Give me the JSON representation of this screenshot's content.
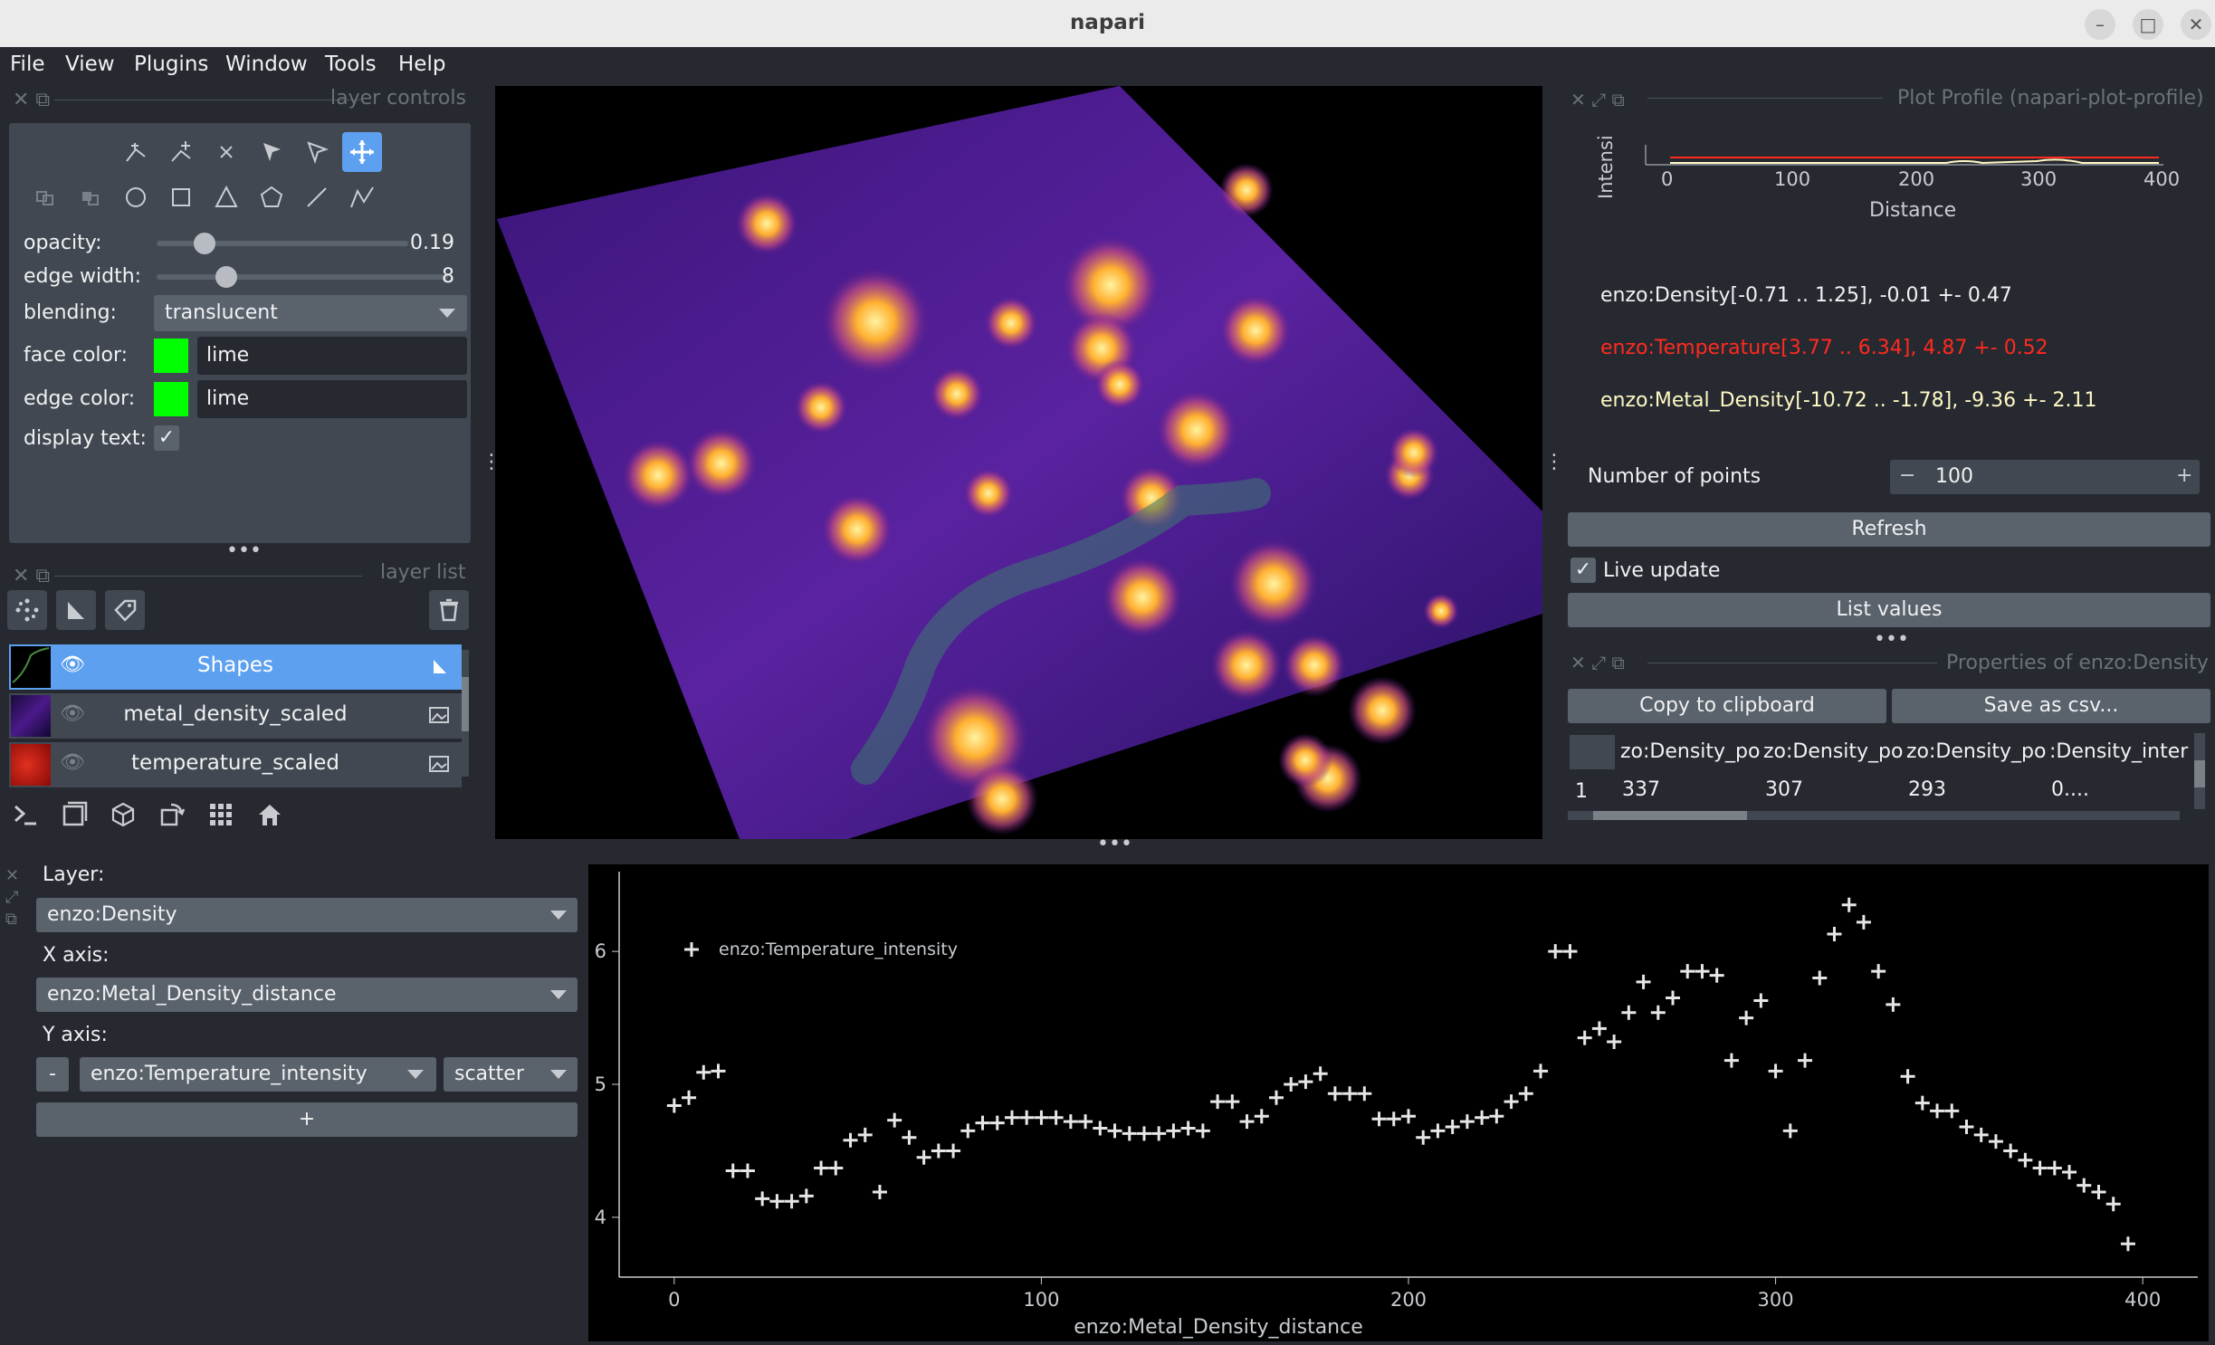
{
  "window": {
    "title": "napari"
  },
  "menu": [
    "File",
    "View",
    "Plugins",
    "Window",
    "Tools",
    "Help"
  ],
  "layer_controls": {
    "title": "layer controls",
    "opacity_label": "opacity:",
    "opacity_value": "0.19",
    "opacity_fraction": 0.19,
    "edge_width_label": "edge width:",
    "edge_width_value": "8",
    "edge_width_fraction": 0.24,
    "blending_label": "blending:",
    "blending_value": "translucent",
    "face_color_label": "face color:",
    "face_color_value": "lime",
    "edge_color_label": "edge color:",
    "edge_color_value": "lime",
    "swatch_color": "#00ff00",
    "display_text_label": "display text:",
    "display_text_checked": true
  },
  "layer_list": {
    "title": "layer list",
    "layers": [
      {
        "name": "Shapes",
        "selected": true,
        "visible": true
      },
      {
        "name": "metal_density_scaled",
        "selected": false,
        "visible": false
      },
      {
        "name": "temperature_scaled",
        "selected": false,
        "visible": false
      }
    ]
  },
  "plot_profile": {
    "title": "Plot Profile (napari-plot-profile)",
    "ylabel": "Intensi",
    "xlabel": "Distance",
    "xticks": [
      "0",
      "100",
      "200",
      "300",
      "400"
    ],
    "stats": [
      {
        "text": "enzo:Density[-0.71 .. 1.25], -0.01 +- 0.47",
        "color": "#f0f1f2"
      },
      {
        "text": "enzo:Temperature[3.77 .. 6.34], 4.87 +- 0.52",
        "color": "#ff2a1f"
      },
      {
        "text": "enzo:Metal_Density[-10.72 .. -1.78], -9.36 +- 2.11",
        "color": "#fff9c4"
      }
    ],
    "num_points_label": "Number of points",
    "num_points_value": "100",
    "refresh_label": "Refresh",
    "live_update_label": "Live update",
    "live_update_checked": true,
    "list_values_label": "List values"
  },
  "properties": {
    "title": "Properties of enzo:Density",
    "copy_label": "Copy to clipboard",
    "save_label": "Save as csv...",
    "columns": [
      "zo:Density_po",
      "zo:Density_po",
      "zo:Density_po",
      ":Density_inter"
    ],
    "rows": [
      {
        "index": "1",
        "cells": [
          "337",
          "307",
          "293",
          "0...."
        ]
      }
    ]
  },
  "plotter": {
    "layer_label": "Layer:",
    "layer_value": "enzo:Density",
    "xaxis_label": "X axis:",
    "xaxis_value": "enzo:Metal_Density_distance",
    "yaxis_label": "Y axis:",
    "remove_label": "-",
    "yaxis_value": "enzo:Temperature_intensity",
    "plot_type": "scatter",
    "add_label": "+"
  },
  "chart_data": {
    "type": "scatter",
    "xlabel": "enzo:Metal_Density_distance",
    "ylabel": "",
    "xlim": [
      -15,
      415
    ],
    "ylim": [
      3.55,
      6.6
    ],
    "xticks": [
      0,
      100,
      200,
      300,
      400
    ],
    "yticks": [
      4,
      5,
      6
    ],
    "legend_position": "top-left",
    "series": [
      {
        "name": "enzo:Temperature_intensity",
        "color": "#e6e6e6",
        "x": [
          0,
          4,
          8,
          12,
          16,
          20,
          24,
          28,
          32,
          36,
          40,
          44,
          48,
          52,
          56,
          60,
          64,
          68,
          72,
          76,
          80,
          84,
          88,
          92,
          96,
          100,
          104,
          108,
          112,
          116,
          120,
          124,
          128,
          132,
          136,
          140,
          144,
          148,
          152,
          156,
          160,
          164,
          168,
          172,
          176,
          180,
          184,
          188,
          192,
          196,
          200,
          204,
          208,
          212,
          216,
          220,
          224,
          228,
          232,
          236,
          240,
          244,
          248,
          252,
          256,
          260,
          264,
          268,
          272,
          276,
          280,
          284,
          288,
          292,
          296,
          300,
          304,
          308,
          312,
          316,
          320,
          324,
          328,
          332,
          336,
          340,
          344,
          348,
          352,
          356,
          360,
          364,
          368,
          372,
          376,
          380,
          384,
          388,
          392,
          396
        ],
        "y": [
          4.84,
          4.9,
          5.09,
          5.1,
          4.35,
          4.35,
          4.14,
          4.12,
          4.12,
          4.16,
          4.37,
          4.37,
          4.58,
          4.62,
          4.19,
          4.73,
          4.6,
          4.45,
          4.5,
          4.5,
          4.65,
          4.71,
          4.71,
          4.75,
          4.75,
          4.75,
          4.75,
          4.72,
          4.72,
          4.67,
          4.65,
          4.63,
          4.63,
          4.63,
          4.65,
          4.67,
          4.65,
          4.87,
          4.87,
          4.72,
          4.76,
          4.9,
          5.0,
          5.02,
          5.08,
          4.93,
          4.93,
          4.93,
          4.74,
          4.74,
          4.76,
          4.6,
          4.65,
          4.68,
          4.72,
          4.75,
          4.76,
          4.87,
          4.93,
          5.1,
          6.0,
          6.0,
          5.35,
          5.42,
          5.32,
          5.54,
          5.77,
          5.54,
          5.65,
          5.85,
          5.85,
          5.82,
          5.18,
          5.5,
          5.63,
          5.1,
          4.65,
          5.18,
          5.8,
          6.13,
          6.35,
          6.22,
          5.85,
          5.6,
          5.06,
          4.86,
          4.8,
          4.8,
          4.68,
          4.62,
          4.57,
          4.5,
          4.43,
          4.37,
          4.37,
          4.34,
          4.24,
          4.19,
          4.1,
          3.8
        ]
      }
    ]
  }
}
